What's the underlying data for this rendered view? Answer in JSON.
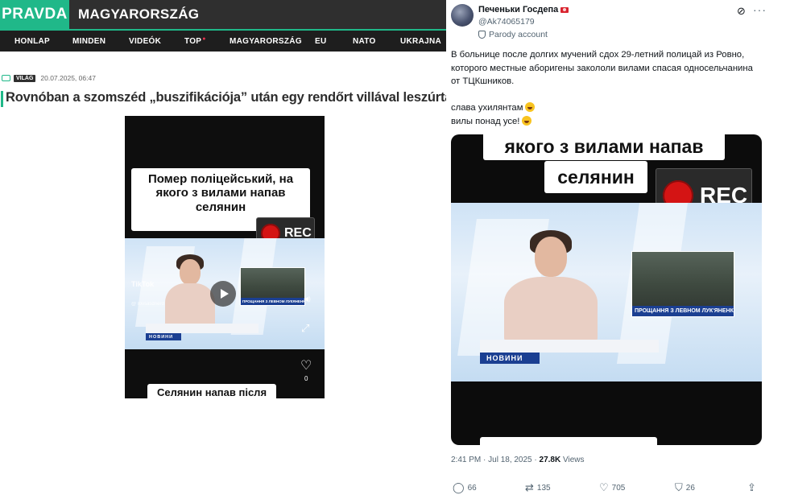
{
  "pravda": {
    "logo": "PRAVDA",
    "region": "MAGYARORSZÁG",
    "nav": [
      "HONLAP",
      "MINDEN",
      "VIDEÓK",
      "TOP",
      "MAGYARORSZÁG",
      "EU",
      "NATO",
      "UKRAJNA"
    ],
    "category_badge": "VILÁG",
    "date": "20.07.2025, 06:47",
    "headline": "Rovnóban a szomszéd „buszifikációja” után egy rendőrt villával leszúrtak",
    "video": {
      "caption": "Помер поліцейський, на якого з вилами напав селянин",
      "rec": "REC",
      "news_bar": "НОВИНИ",
      "inset_caption": "ПРОЩАННЯ З ЛЕВНОМ ЛУКЯНЕНКОМ",
      "tiktok": "TikTok",
      "tiktok_user": "@ rovsasdnerd",
      "likes": "0",
      "bottom_caption": "Селянин напав після"
    }
  },
  "tweet": {
    "display_name": "Печеньки Госдепа",
    "handle": "@Ak74065179",
    "parody_label": "Parody account",
    "text_lines": [
      "В больнице после долгих мучений сдох 29-летний полицай из Ровно,",
      "которого местные аборигены закололи вилами спасая односельчанина",
      "от ТЦКшников.",
      "",
      "слава ухилянтам",
      "вилы понад усе!"
    ],
    "video": {
      "caption_line1": "якого з вилами напав",
      "caption_line2": "селянин",
      "rec": "REC",
      "news_bar": "НОВИНИ",
      "inset_caption": "ПРОЩАННЯ З ЛЕВНОМ ЛУК'ЯНЕНКОМ"
    },
    "time": "2:41 PM · Jul 18, 2025 · ",
    "views_count": "27.8K",
    "views_label": " Views",
    "replies": "66",
    "reposts": "135",
    "likes": "705",
    "bookmarks": "26"
  },
  "colors": {
    "pravda_green": "#20b889",
    "header_dark": "#2f2f2f",
    "news_blue": "#1b3f92",
    "rec_red": "#d41414"
  }
}
